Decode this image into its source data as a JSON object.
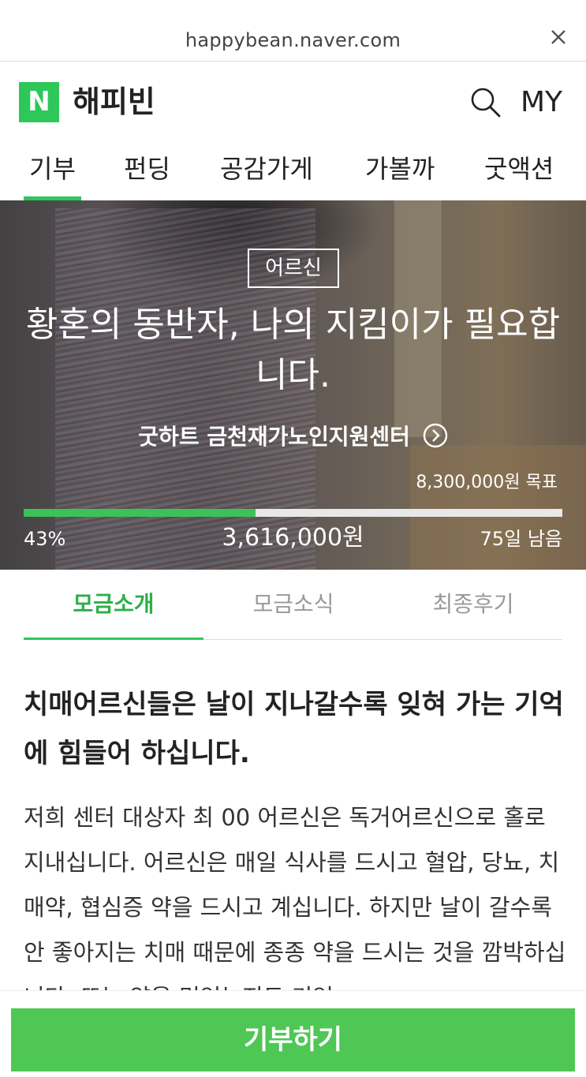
{
  "browser": {
    "url": "happybean.naver.com",
    "close_icon": "close-icon"
  },
  "header": {
    "logo_letter": "N",
    "brand": "해피빈",
    "search_icon": "search-icon",
    "my_label": "MY"
  },
  "nav": {
    "tabs": [
      "기부",
      "펀딩",
      "공감가게",
      "가볼까",
      "굿액션"
    ],
    "active_index": 0
  },
  "campaign": {
    "category": "어르신",
    "title": "황혼의 동반자, 나의 지킴이가 필요합니다.",
    "organization": "굿하트 금천재가노인지원센터",
    "goal_text": "8,300,000원 목표",
    "progress_fraction": 0.43,
    "percent_text": "43%",
    "amount_text": "3,616,000원",
    "days_left_text": "75일 남음"
  },
  "subtabs": {
    "items": [
      "모금소개",
      "모금소식",
      "최종후기"
    ],
    "active_index": 0
  },
  "article": {
    "headline": "치매어르신들은 날이 지나갈수록 잊혀 가는 기억에 힘들어 하십니다.",
    "body": "저희 센터 대상자 최 00 어르신은 독거어르신으로 홀로 지내십니다. 어르신은 매일 식사를 드시고 혈압, 당뇨, 치매약, 협심증 약을 드시고 계십니다. 하지만 날이 갈수록 안 좋아지는 치매 때문에 종종 약을 드시는 것을 깜박하십니다. 또는 약을 먹었는지도 기억"
  },
  "cta": {
    "label": "기부하기"
  },
  "colors": {
    "accent": "#2ec75a",
    "button": "#4fc754",
    "active_subtab": "#2fae4b"
  }
}
